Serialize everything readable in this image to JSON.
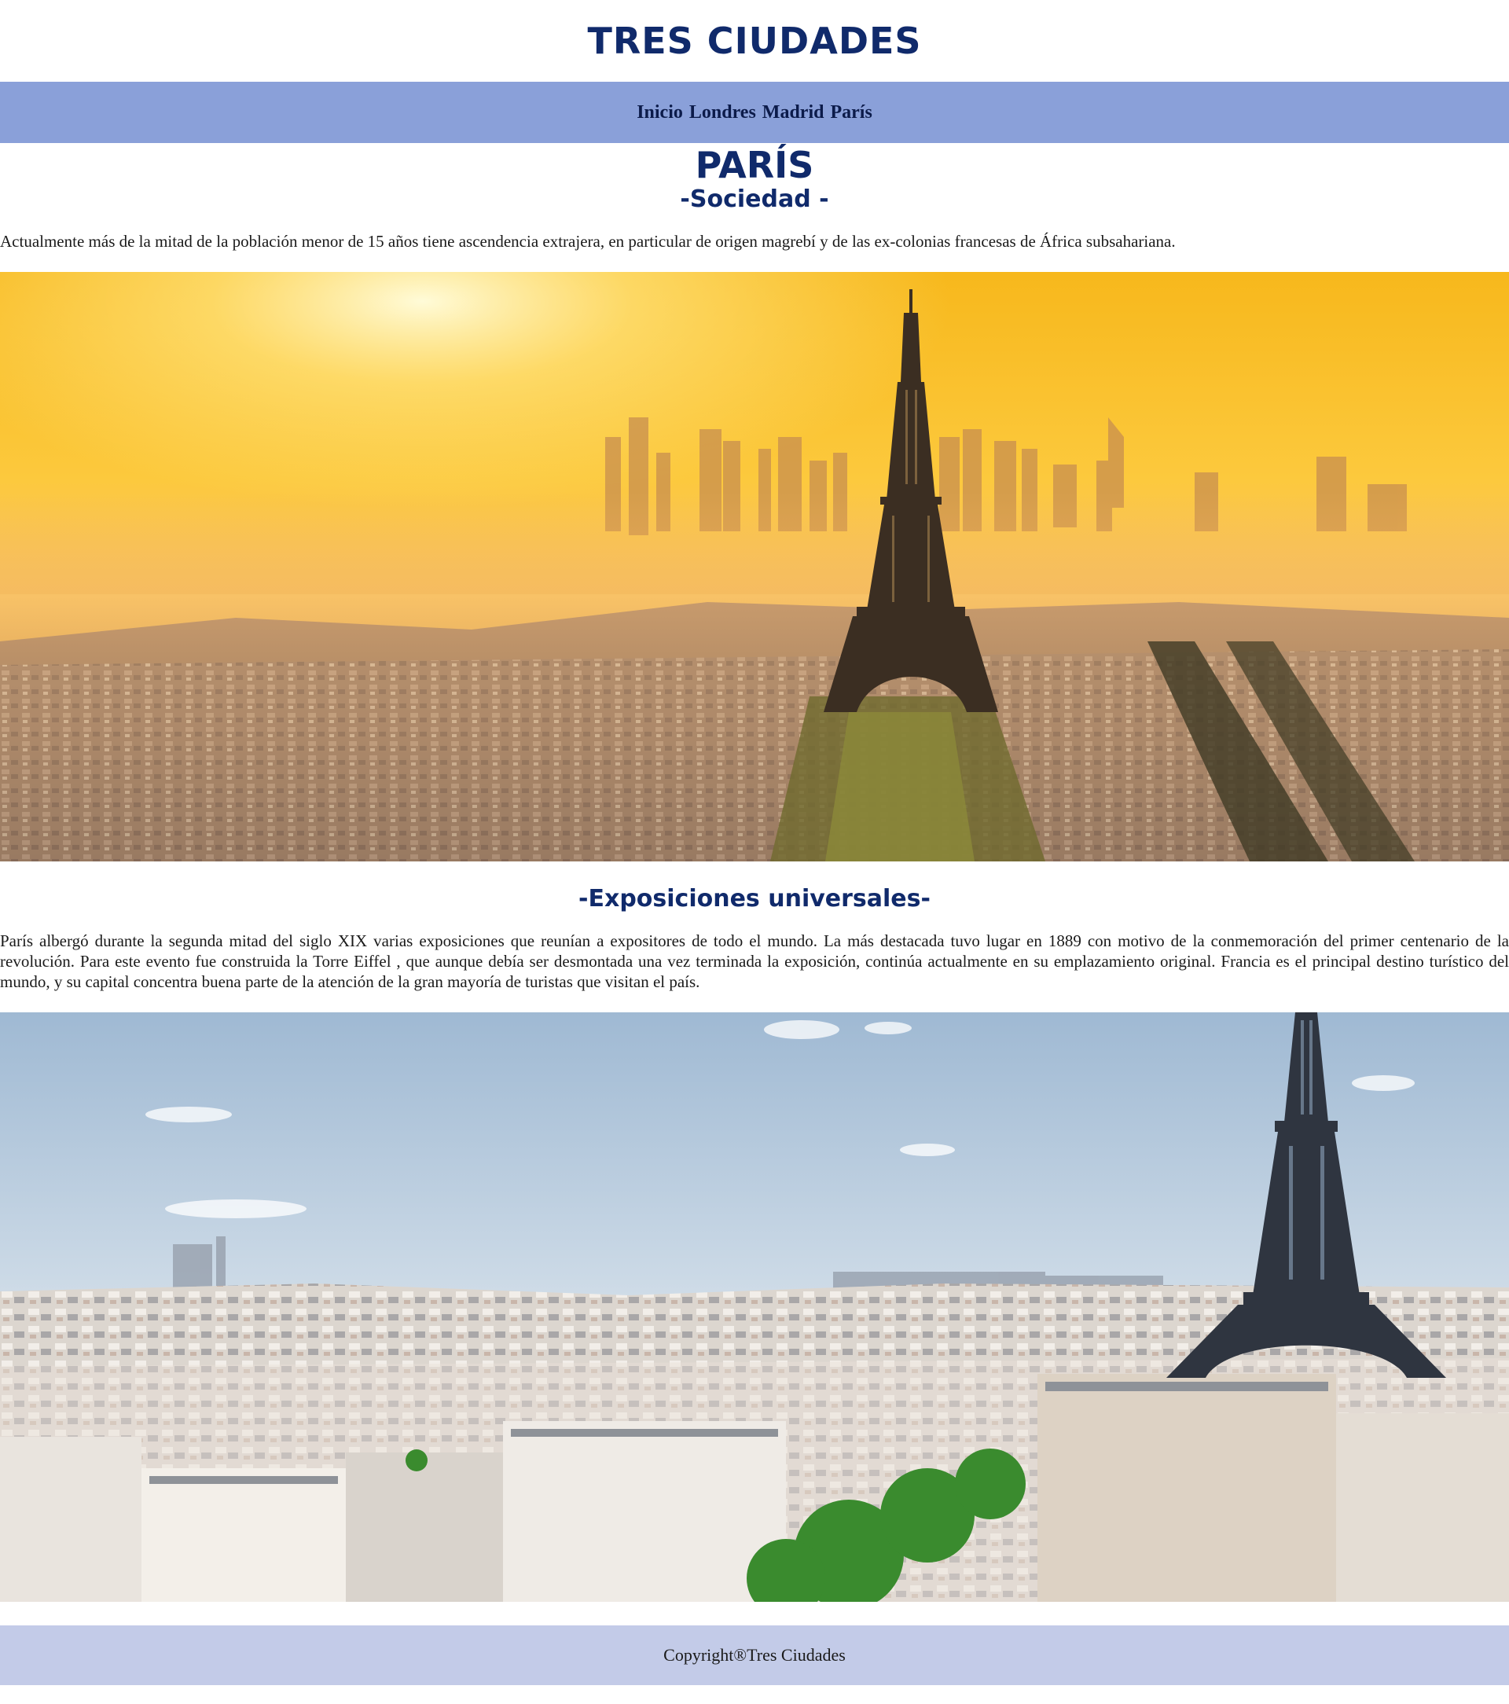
{
  "site": {
    "title": "TRES CIUDADES"
  },
  "nav": {
    "items": [
      "Inicio",
      "Londres",
      "Madrid",
      "París"
    ]
  },
  "page": {
    "city_title": "PARÍS",
    "section1_title": "-Sociedad -",
    "section1_text": "Actualmente más de la mitad de la población menor de 15 años tiene ascendencia extrajera, en particular de origen magrebí y de las ex-colonias francesas de África subsahariana.",
    "section2_title": "-Exposiciones universales-",
    "section2_text": "París albergó durante la segunda mitad del siglo XIX varias exposiciones que reunían a expositores de todo el mundo. La más destacada tuvo lugar en 1889 con motivo de la conmemoración del primer centenario de la revolución. Para este evento fue construida la Torre Eiffel , que aunque debía ser desmontada una vez terminada la exposición, continúa actualmente en su emplazamiento original. Francia es el principal destino turístico del mundo, y su capital concentra buena parte de la atención de la gran mayoría de turistas que visitan el país."
  },
  "footer": {
    "text": "Copyright®Tres Ciudades"
  },
  "colors": {
    "title": "#102a6b",
    "nav_bg": "#8aa0d9",
    "footer_bg": "#c3cbe8"
  }
}
